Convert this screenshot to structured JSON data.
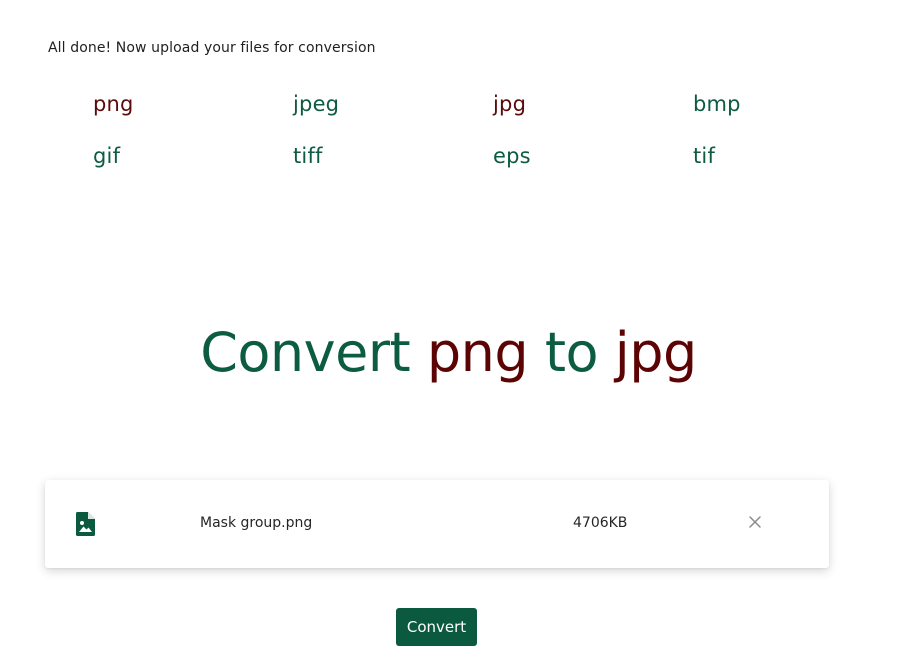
{
  "status_message": "All done! Now upload your files for conversion",
  "formats": [
    {
      "label": "png",
      "selected": true
    },
    {
      "label": "jpeg",
      "selected": false
    },
    {
      "label": "jpg",
      "selected": false
    },
    {
      "label": "bmp",
      "selected": false
    },
    {
      "label": "gif",
      "selected": false
    },
    {
      "label": "tiff",
      "selected": false
    },
    {
      "label": "eps",
      "selected": false
    },
    {
      "label": "tif",
      "selected": false
    }
  ],
  "headline": {
    "prefix": "Convert",
    "from": "png",
    "to_word": "to",
    "to": "jpg"
  },
  "file": {
    "icon": "image-file-icon",
    "name": "Mask group.png",
    "size": "4706KB",
    "remove_icon": "close-icon"
  },
  "convert_button": "Convert",
  "colors": {
    "brand_green": "#0b5a40",
    "accent_red": "#5c0303",
    "background": "#ffffff"
  }
}
